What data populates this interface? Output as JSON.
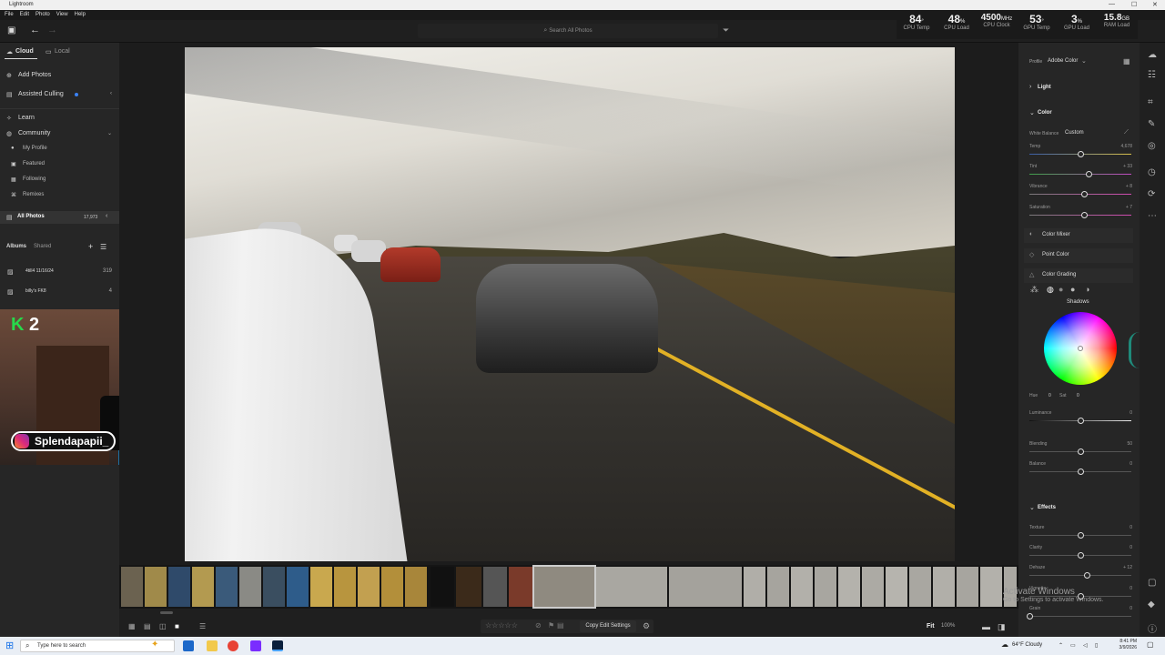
{
  "window": {
    "title": "Lightroom",
    "controls": [
      "—",
      "☐",
      "✕"
    ]
  },
  "menu": [
    "File",
    "Edit",
    "Photo",
    "View",
    "Help"
  ],
  "search": {
    "placeholder": "Search All Photos"
  },
  "stats": [
    {
      "value": "84",
      "unit": "°",
      "label": "CPU Temp"
    },
    {
      "value": "48",
      "unit": "%",
      "label": "CPU Load"
    },
    {
      "value": "4500",
      "unit": "MHz",
      "label": "CPU Clock"
    },
    {
      "value": "53",
      "unit": "°",
      "label": "GPU Temp"
    },
    {
      "value": "3",
      "unit": "%",
      "label": "GPU Load"
    },
    {
      "value": "15.8",
      "unit": "GB",
      "label": "RAM Load"
    }
  ],
  "left": {
    "tabs": {
      "cloud": "Cloud",
      "local": "Local"
    },
    "add_photos": "Add Photos",
    "assisted_culling": "Assisted Culling",
    "learn": "Learn",
    "community": "Community",
    "community_items": [
      "My Profile",
      "Featured",
      "Following",
      "Remixes"
    ],
    "all_photos": "All Photos",
    "all_photos_count": "17,973",
    "albums_tab": "Albums",
    "shared_tab": "Shared",
    "albums": [
      {
        "name": "4till4 11/16/24",
        "count": "319"
      },
      {
        "name": "billy's FK8",
        "count": "4"
      }
    ]
  },
  "overlay": {
    "badge_k": "K",
    "badge_num": "2",
    "instagram": "Splendapapii_"
  },
  "bottom": {
    "copy_edit": "Copy Edit Settings",
    "fit": "Fit",
    "zoom": "100%"
  },
  "right": {
    "profile_label": "Profile",
    "profile_value": "Adobe Color",
    "light": "Light",
    "color": "Color",
    "white_balance_label": "White Balance",
    "white_balance_value": "Custom",
    "sliders_color": [
      {
        "label": "Temp",
        "value": "4,678",
        "pos": 0.5
      },
      {
        "label": "Tint",
        "value": "+ 33",
        "pos": 0.58
      },
      {
        "label": "Vibrance",
        "value": "+ 8",
        "pos": 0.54
      },
      {
        "label": "Saturation",
        "value": "+ 7",
        "pos": 0.54
      }
    ],
    "color_mixer": "Color Mixer",
    "point_color": "Point Color",
    "color_grading": "Color Grading",
    "grading_mode": "Shadows",
    "hue_label": "Hue",
    "hue_value": "0",
    "sat_label": "Sat",
    "sat_value": "0",
    "luminance_label": "Luminance",
    "luminance_value": "0",
    "luminance_pos": 0.5,
    "blending_label": "Blending",
    "blending_value": "50",
    "blending_pos": 0.5,
    "balance_label": "Balance",
    "balance_value": "0",
    "balance_pos": 0.5,
    "effects": "Effects",
    "sliders_effects": [
      {
        "label": "Texture",
        "value": "0",
        "pos": 0.5
      },
      {
        "label": "Clarity",
        "value": "0",
        "pos": 0.5
      },
      {
        "label": "Dehaze",
        "value": "+ 12",
        "pos": 0.56
      },
      {
        "label": "Vignette",
        "value": "0",
        "pos": 0.5
      },
      {
        "label": "Grain",
        "value": "0",
        "pos": 0.0
      }
    ]
  },
  "activate": {
    "title": "Activate Windows",
    "subtitle": "Go to Settings to activate Windows."
  },
  "taskbar": {
    "search_placeholder": "Type here to search",
    "weather": "64°F  Cloudy",
    "time": "8:41 PM",
    "date": "3/9/2026"
  }
}
